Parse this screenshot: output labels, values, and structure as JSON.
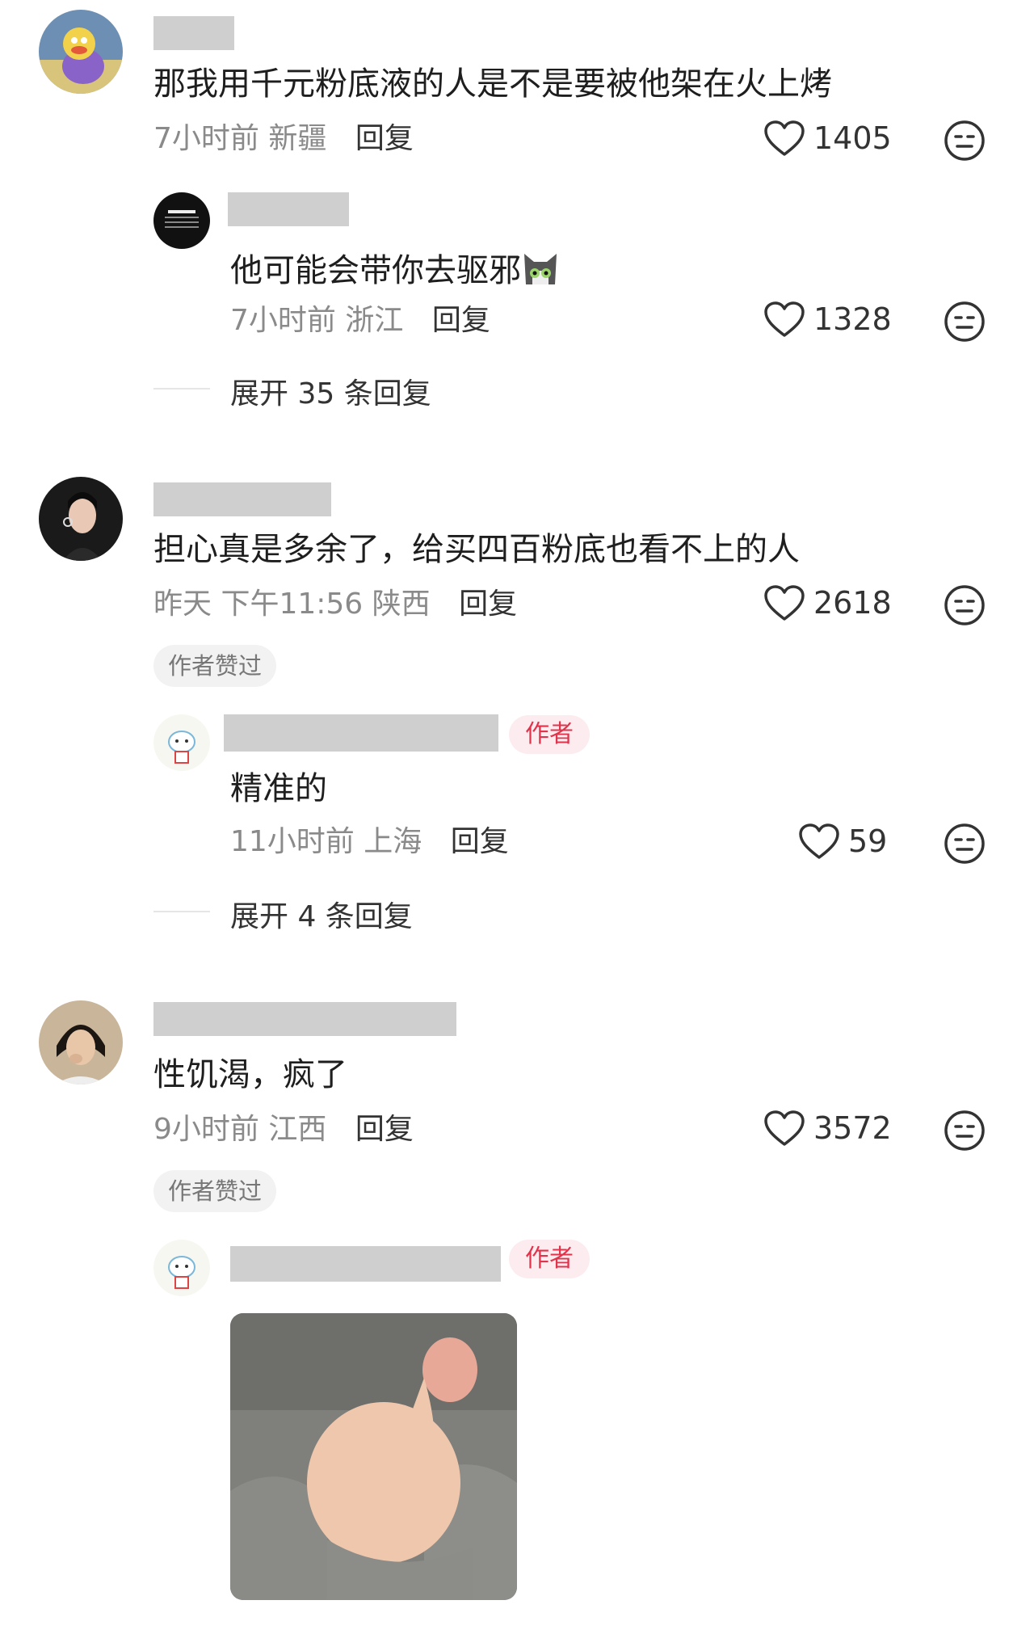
{
  "comments": [
    {
      "text": "那我用千元粉底液的人是不是要被他架在火上烤",
      "time": "7小时前",
      "region": "新疆",
      "reply_label": "回复",
      "likes": "1405"
    },
    {
      "text": "担心真是多余了，给买四百粉底也看不上的人",
      "time": "昨天 下午11:56",
      "region": "陕西",
      "reply_label": "回复",
      "likes": "2618",
      "author_liked": "作者赞过"
    },
    {
      "text": "性饥渴，疯了",
      "time": "9小时前",
      "region": "江西",
      "reply_label": "回复",
      "likes": "3572",
      "author_liked": "作者赞过"
    }
  ],
  "replies": [
    {
      "text": "他可能会带你去驱邪",
      "time": "7小时前",
      "region": "浙江",
      "reply_label": "回复",
      "likes": "1328"
    },
    {
      "author_tag": "作者",
      "text": "精准的",
      "time": "11小时前",
      "region": "上海",
      "reply_label": "回复",
      "likes": "59"
    },
    {
      "author_tag": "作者"
    }
  ],
  "expand": [
    "展开 35 条回复",
    "展开 4 条回复"
  ],
  "colors": {
    "author_tag_text": "#e0344c",
    "author_tag_bg": "#fdecef",
    "meta_text": "#8a8a8a",
    "redaction_bar": "#cfcfcf"
  },
  "icons": {
    "like": "heart-outline-icon",
    "dislike": "neutral-face-icon",
    "inline_emoji": "cat-face-emoji"
  }
}
